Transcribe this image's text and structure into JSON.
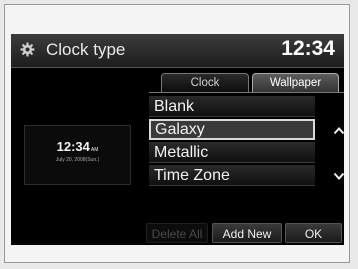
{
  "header": {
    "title": "Clock type",
    "time": "12:34",
    "icon": "gear-icon"
  },
  "tabs": [
    {
      "label": "Clock",
      "active": false
    },
    {
      "label": "Wallpaper",
      "active": true
    }
  ],
  "preview": {
    "time": "12:34",
    "ampm": "AM",
    "date": "July 20, 2008(Sun.)"
  },
  "list": {
    "items": [
      {
        "label": "Blank",
        "selected": false
      },
      {
        "label": "Galaxy",
        "selected": true
      },
      {
        "label": "Metallic",
        "selected": false
      },
      {
        "label": "Time Zone",
        "selected": false
      }
    ],
    "scroll_up_icon": "chevron-up-icon",
    "scroll_down_icon": "chevron-down-icon"
  },
  "buttons": {
    "delete_all": "Delete All",
    "add_new": "Add New",
    "ok": "OK"
  },
  "colors": {
    "screen_bg": "#000000",
    "selection_border": "#d9d9d9",
    "disabled_text": "#4a4a4a"
  }
}
